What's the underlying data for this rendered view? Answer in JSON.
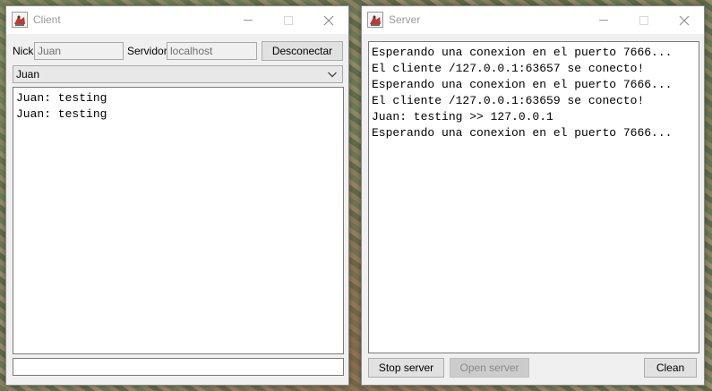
{
  "client": {
    "title": "Client",
    "nick_label": "Nick",
    "nick_value": "Juan",
    "server_label": "Servidor",
    "server_value": "localhost",
    "disconnect_label": "Desconectar",
    "user_select": "Juan",
    "messages": [
      "Juan: testing",
      "Juan: testing"
    ],
    "message_input": ""
  },
  "server": {
    "title": "Server",
    "log": [
      "Esperando una conexion en el puerto 7666...",
      "El cliente /127.0.0.1:63657 se conecto!",
      "Esperando una conexion en el puerto 7666...",
      "El cliente /127.0.0.1:63659 se conecto!",
      "Juan: testing >> 127.0.0.1",
      "Esperando una conexion en el puerto 7666..."
    ],
    "stop_label": "Stop server",
    "open_label": "Open server",
    "clean_label": "Clean"
  },
  "icons": {
    "app": "java-app-icon",
    "minimize": "minimize-icon",
    "maximize": "maximize-icon",
    "close": "close-icon",
    "dropdown": "chevron-down-icon"
  }
}
